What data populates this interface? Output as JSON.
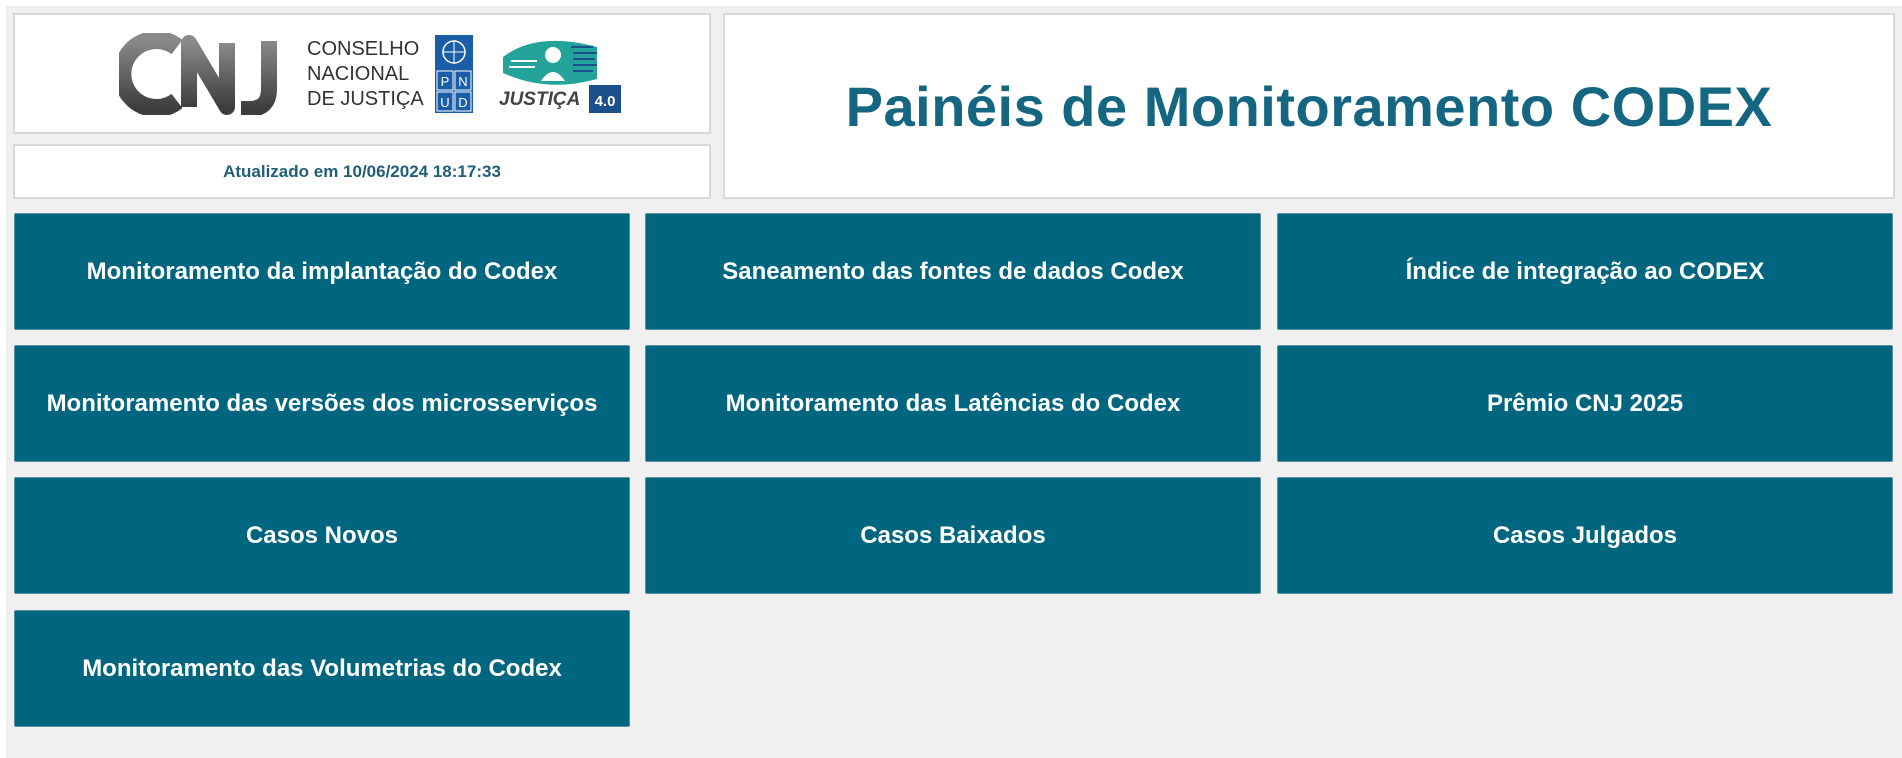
{
  "header": {
    "logo_lines": [
      "CONSELHO",
      "NACIONAL",
      "DE JUSTIÇA"
    ],
    "pnud_letters": [
      "P",
      "N",
      "U",
      "D"
    ],
    "justica_text": "JUSTIÇA",
    "justica_version": "4.0",
    "updated": "Atualizado em 10/06/2024 18:17:33",
    "title": "Painéis de Monitoramento CODEX"
  },
  "tiles": [
    "Monitoramento da implantação do Codex",
    "Saneamento das fontes de dados Codex",
    "Índice de integração ao CODEX",
    "Monitoramento das versões dos microsserviços",
    "Monitoramento das Latências do Codex",
    "Prêmio CNJ 2025",
    "Casos Novos",
    "Casos Baixados",
    "Casos Julgados",
    "Monitoramento das Volumetrias do Codex"
  ],
  "colors": {
    "tile_bg": "#006680",
    "title_color": "#156680",
    "background": "#f0f0f0"
  }
}
